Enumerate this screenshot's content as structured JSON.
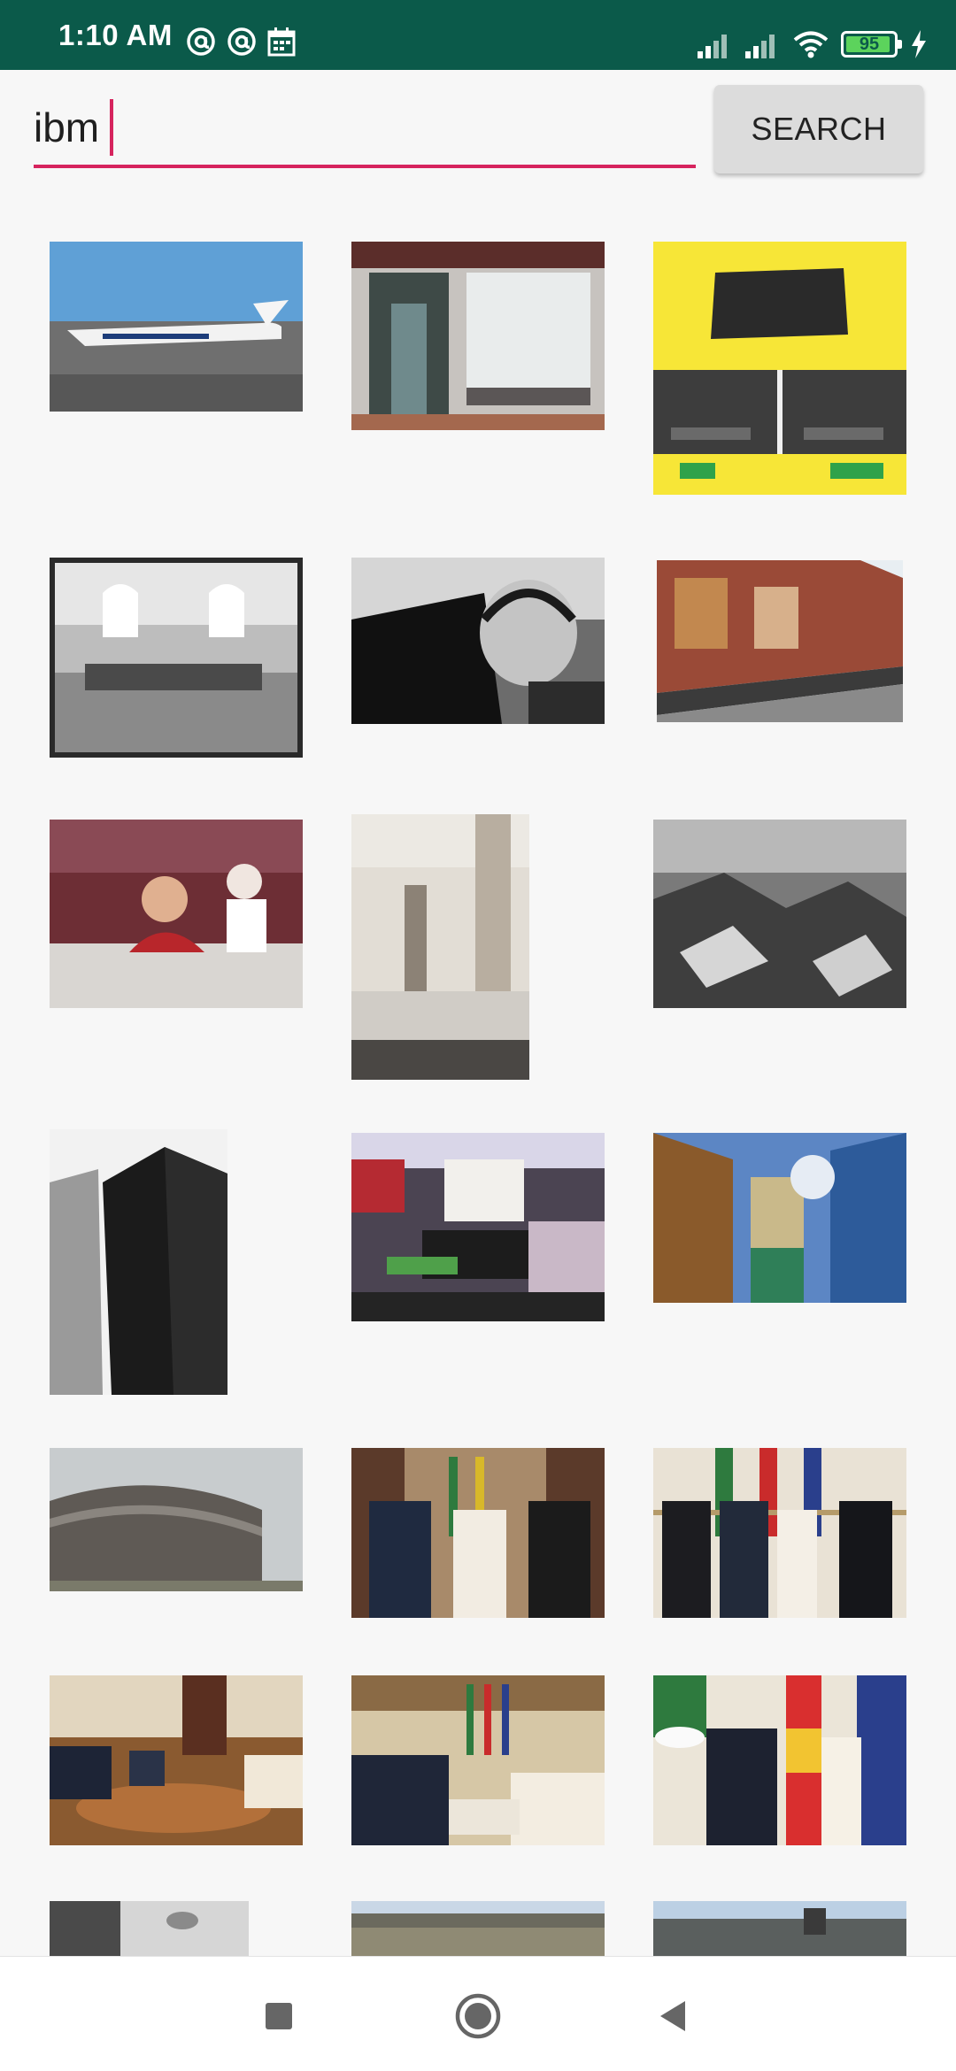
{
  "status_bar": {
    "time": "1:10 AM",
    "battery_level": "95",
    "battery_fraction": 0.95,
    "icons": [
      "at-sign-icon",
      "at-sign-icon",
      "calendar-icon",
      "signal-icon",
      "signal-icon",
      "wifi-icon",
      "battery-icon",
      "charging-bolt-icon"
    ]
  },
  "search": {
    "query": "ibm",
    "button_label": "SEARCH"
  },
  "colors": {
    "status_bar": "#0b5a4a",
    "accent": "#d6245e",
    "background": "#f7f7f7",
    "button": "#dcdcdc"
  },
  "results": [
    "business-jet-on-tarmac",
    "building-entrance-162",
    "ieri-astazi-laptop-comparison",
    "vintage-lobby-photo",
    "person-with-headset-and-laptop",
    "graffiti-freight-train",
    "restaurant-diners",
    "concrete-colonnade",
    "aerial-mountains",
    "dark-skyscraper",
    "store-do-not-take-down-sign",
    "modern-tower-blue-sky",
    "curved-building-facade",
    "officials-meeting-flags",
    "officials-group-portrait",
    "meeting-in-ornate-room",
    "meeting-with-flags",
    "officials-pair-flags",
    "partial-image",
    "partial-city-panorama",
    "partial-rooftop-panorama"
  ],
  "nav_bar": {
    "buttons": [
      "recent-apps-icon",
      "home-icon",
      "back-icon"
    ]
  }
}
